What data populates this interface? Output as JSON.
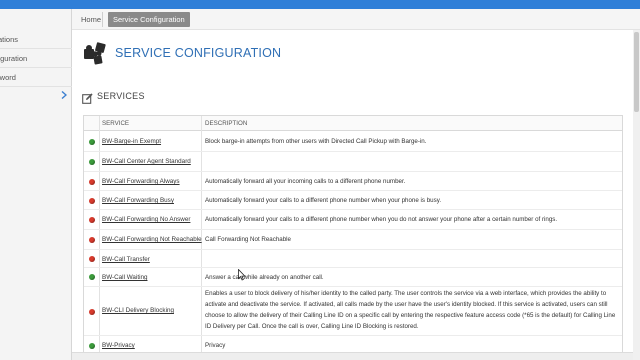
{
  "breadcrumb": {
    "home": "Home",
    "current": "Service Configuration"
  },
  "sidebar": {
    "items": [
      {
        "label": "istrations"
      },
      {
        "label": "onfiguration"
      },
      {
        "label": "assword"
      }
    ],
    "toggle_icon": "chevron-right-icon"
  },
  "page": {
    "title": "SERVICE CONFIGURATION",
    "icon": "puzzle-icon"
  },
  "section": {
    "title": "SERVICES",
    "icon": "edit-icon"
  },
  "table": {
    "headers": {
      "service": "SERVICE",
      "description": "DESCRIPTION"
    },
    "rows": [
      {
        "status": "green",
        "service": "BW-Barge-in Exempt",
        "description": "Block barge-in attempts from other users with Directed Call Pickup with Barge-in."
      },
      {
        "status": "green",
        "service": "BW-Call Center Agent Standard",
        "description": ""
      },
      {
        "status": "red",
        "service": "BW-Call Forwarding Always",
        "description": "Automatically forward all your incoming calls to a different phone number."
      },
      {
        "status": "red",
        "service": "BW-Call Forwarding Busy",
        "description": "Automatically forward your calls to a different phone number when your phone is busy."
      },
      {
        "status": "red",
        "service": "BW-Call Forwarding No Answer",
        "description": "Automatically forward your calls to a different phone number when you do not answer your phone after a certain number of rings."
      },
      {
        "status": "red",
        "service": "BW-Call Forwarding Not Reachable",
        "description": "Call Forwarding Not Reachable"
      },
      {
        "status": "red",
        "service": "BW-Call Transfer",
        "description": ""
      },
      {
        "status": "green",
        "service": "BW-Call Waiting",
        "description": "Answer a call while already on another call."
      },
      {
        "status": "red",
        "service": "BW-CLI Delivery Blocking",
        "description": "Enables a user to block delivery of his/her identity to the called party. The user controls the service via a web interface, which provides the ability to activate and deactivate the service. If activated, all calls made by the user have the user's identity blocked. If this service is activated, users can still choose to allow the delivery of their Calling Line ID on a specific call by entering the respective feature access code (*65 is the default) for Calling Line ID Delivery per Call. Once the call is over, Calling Line ID Blocking is restored."
      },
      {
        "status": "green",
        "service": "BW-Privacy",
        "description": "Privacy"
      }
    ]
  },
  "colors": {
    "accent": "#2f6fb5",
    "topbar": "#2f7fd8",
    "status_green": "#3b9b3b",
    "status_red": "#d83a2c"
  }
}
